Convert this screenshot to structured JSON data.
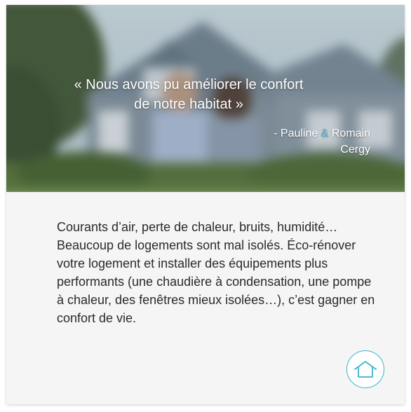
{
  "testimonial": {
    "quote_line1": "« Nous avons pu améliorer le confort",
    "quote_line2": "de notre habitat »",
    "author_prefix": "- Pauline",
    "author_amp": "&",
    "author_second": "Romain",
    "city": "Cergy"
  },
  "body": {
    "text": "Courants d’air, perte de chaleur, bruits, humidité… Beaucoup de logements sont mal isolés. Éco-rénover votre logement et installer des équipements plus performants (une chaudière à condensation, une pompe à chaleur, des fenêtres mieux isolées…), c’est gagner en confort de vie."
  },
  "home_button": {
    "icon": "home-icon"
  },
  "colors": {
    "accent": "#3fb3c9",
    "card_background": "#f5f5f5",
    "body_text": "#2a2a2a"
  }
}
